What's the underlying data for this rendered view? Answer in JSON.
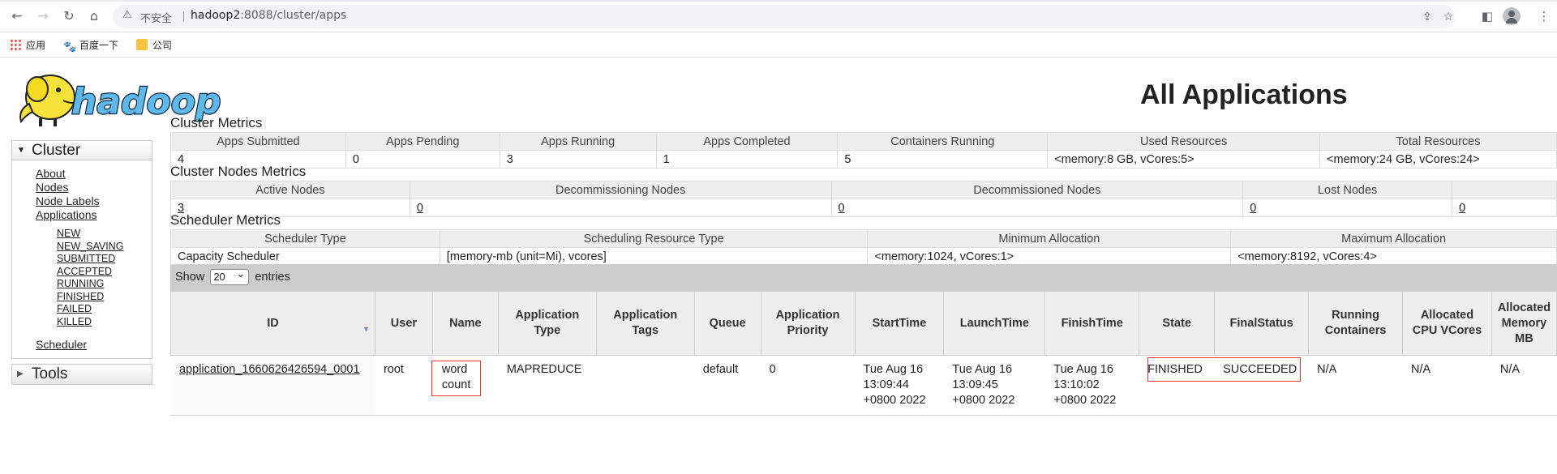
{
  "browser": {
    "insecure_label": "不安全",
    "url_host": "hadoop2",
    "url_rest": ":8088/cluster/apps",
    "bookmarks": [
      {
        "label": "应用",
        "icon": "apps-grid-icon"
      },
      {
        "label": "百度一下",
        "icon": "baidu-paw-icon"
      },
      {
        "label": "公司",
        "icon": "folder-icon"
      }
    ]
  },
  "page": {
    "title": "All Applications",
    "logo_text": "hadoop"
  },
  "nav": {
    "cluster_label": "Cluster",
    "links": [
      "About",
      "Nodes",
      "Node Labels",
      "Applications"
    ],
    "app_states": [
      "NEW",
      "NEW_SAVING",
      "SUBMITTED",
      "ACCEPTED",
      "RUNNING",
      "FINISHED",
      "FAILED",
      "KILLED"
    ],
    "scheduler_label": "Scheduler",
    "tools_label": "Tools"
  },
  "cluster_metrics": {
    "title": "Cluster Metrics",
    "headers": [
      "Apps Submitted",
      "Apps Pending",
      "Apps Running",
      "Apps Completed",
      "Containers Running",
      "Used Resources",
      "Total Resources"
    ],
    "values": [
      "4",
      "0",
      "3",
      "1",
      "5",
      "<memory:8 GB, vCores:5>",
      "<memory:24 GB, vCores:24>"
    ]
  },
  "node_metrics": {
    "title": "Cluster Nodes Metrics",
    "headers": [
      "Active Nodes",
      "Decommissioning Nodes",
      "Decommissioned Nodes",
      "Lost Nodes",
      ""
    ],
    "values": [
      "3",
      "0",
      "0",
      "0",
      "0"
    ]
  },
  "scheduler_metrics": {
    "title": "Scheduler Metrics",
    "headers": [
      "Scheduler Type",
      "Scheduling Resource Type",
      "Minimum Allocation",
      "Maximum Allocation"
    ],
    "values": [
      "Capacity Scheduler",
      "[memory-mb (unit=Mi), vcores]",
      "<memory:1024, vCores:1>",
      "<memory:8192, vCores:4>"
    ]
  },
  "apps_table": {
    "show_label": "Show",
    "page_size": "20",
    "entries_label": "entries",
    "headers": [
      "ID",
      "User",
      "Name",
      "Application Type",
      "Application Tags",
      "Queue",
      "Application Priority",
      "StartTime",
      "LaunchTime",
      "FinishTime",
      "State",
      "FinalStatus",
      "Running Containers",
      "Allocated CPU VCores",
      "Allocated Memory MB"
    ],
    "rows": [
      {
        "id": "application_1660626426594_0001",
        "user": "root",
        "name_line1": "word",
        "name_line2": "count",
        "type": "MAPREDUCE",
        "tags": "",
        "queue": "default",
        "priority": "0",
        "start": [
          "Tue Aug 16",
          "13:09:44",
          "+0800 2022"
        ],
        "launch": [
          "Tue Aug 16",
          "13:09:45",
          "+0800 2022"
        ],
        "finish": [
          "Tue Aug 16",
          "13:10:02",
          "+0800 2022"
        ],
        "state": "FINISHED",
        "final_status": "SUCCEEDED",
        "running_containers": "N/A",
        "allocated_vcores": "N/A",
        "allocated_memory": "N/A"
      }
    ]
  }
}
